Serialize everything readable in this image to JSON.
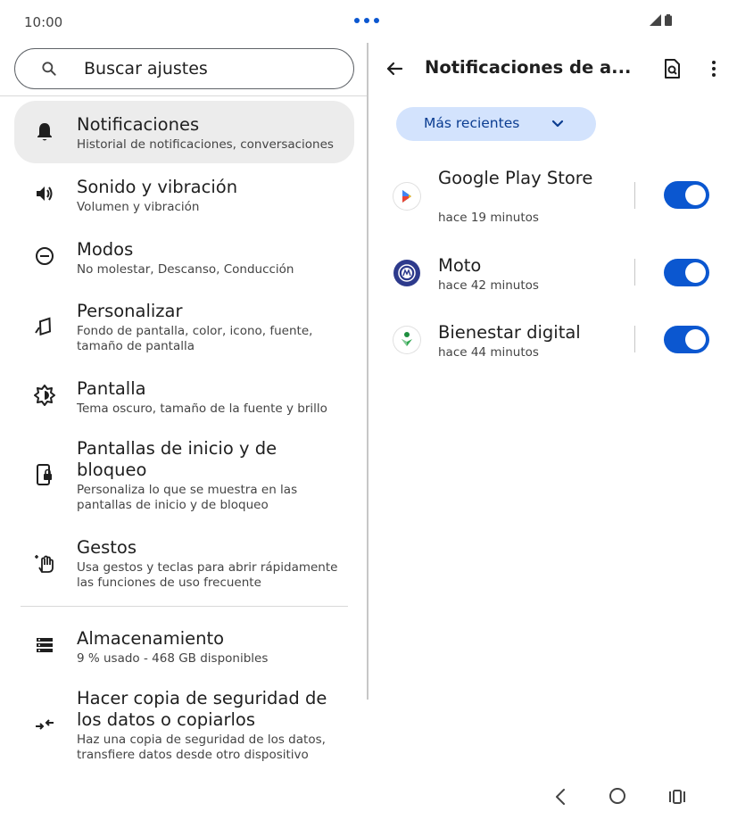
{
  "status": {
    "time": "10:00"
  },
  "search": {
    "placeholder": "Buscar ajustes"
  },
  "settings_items": [
    {
      "title": "Notificaciones",
      "subtitle": "Historial de notificaciones, conversaciones",
      "icon": "bell-icon",
      "selected": true
    },
    {
      "title": "Sonido y vibración",
      "subtitle": "Volumen y vibración",
      "icon": "speaker-icon"
    },
    {
      "title": "Modos",
      "subtitle": "No molestar, Descanso, Conducción",
      "icon": "minus-circle-icon"
    },
    {
      "title": "Personalizar",
      "subtitle": "Fondo de pantalla, color, icono, fuente, tamaño de pantalla",
      "icon": "palette-brush-icon"
    },
    {
      "title": "Pantalla",
      "subtitle": "Tema oscuro, tamaño de la fuente y brillo",
      "icon": "brightness-icon"
    },
    {
      "title": "Pantallas de inicio y de bloqueo",
      "subtitle": "Personaliza lo que se muestra en las pantallas de inicio y de bloqueo",
      "icon": "phone-lock-icon"
    },
    {
      "title": "Gestos",
      "subtitle": "Usa gestos y teclas para abrir rápidamente las funciones de uso frecuente",
      "icon": "hand-gesture-icon"
    },
    {
      "title": "Almacenamiento",
      "subtitle": "9 % usado - 468 GB disponibles",
      "icon": "storage-icon"
    },
    {
      "title": "Hacer copia de seguridad de los datos o copiarlos",
      "subtitle": "Haz una copia de seguridad de los datos, transfiere datos desde otro dispositivo",
      "icon": "transfer-arrows-icon"
    }
  ],
  "detail": {
    "title": "Notificaciones de a...",
    "filter_label": "Más recientes",
    "apps": [
      {
        "name": "Google Play Store",
        "time": "hace 19 minutos",
        "enabled": true,
        "icon": "google-play-icon"
      },
      {
        "name": "Moto",
        "time": "hace 42 minutos",
        "enabled": true,
        "icon": "moto-icon"
      },
      {
        "name": "Bienestar digital",
        "time": "hace 44 minutos",
        "enabled": true,
        "icon": "digital-wellbeing-icon"
      }
    ]
  },
  "colors": {
    "accent": "#0b57d0",
    "chip_bg": "#d3e3fd",
    "selected_bg": "#ececec"
  }
}
